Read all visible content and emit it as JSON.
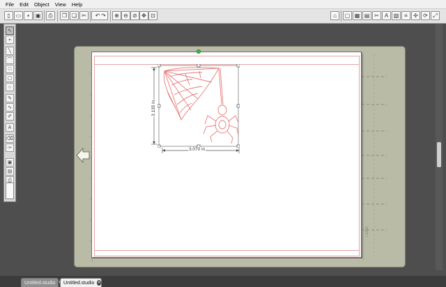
{
  "menu": [
    "File",
    "Edit",
    "Object",
    "View",
    "Help"
  ],
  "toolbar": {
    "left_icons": [
      "new-icon",
      "open-icon",
      "save-icon",
      "save-as-icon",
      "print-icon",
      "cut-icon",
      "copy-icon",
      "paste-icon",
      "scissors-icon",
      "undo-icon",
      "redo-icon",
      "zoom-in-icon",
      "zoom-out-icon",
      "zoom-box-icon",
      "pan-icon",
      "fit-to-window-icon"
    ],
    "right_icons": [
      "store-icon",
      "page-settings-icon",
      "grid-icon",
      "registration-icon",
      "cut-settings-icon",
      "text-style-icon",
      "fill-color-icon",
      "line-color-icon",
      "line-style-icon",
      "move-icon",
      "rotate-icon",
      "scale-icon",
      "replicate-icon",
      "trace-icon"
    ]
  },
  "tools": [
    "select-tool",
    "point-edit-tool",
    "line-tool",
    "polygon-tool",
    "curve-tool",
    "arc-tool",
    "rectangle-tool",
    "rounded-rectangle-tool",
    "ellipse-tool",
    "polyline-tool",
    "freehand-tool",
    "smooth-freehand-tool",
    "text-tool",
    "eraser-tool",
    "knife-tool",
    "zoom-mode-tool",
    "library-tool",
    "send-to-cutter-tool"
  ],
  "design": {
    "width_label": "3.070 in",
    "height_label": "3.135 in"
  },
  "mat": {
    "label": "Letter"
  },
  "tabs": [
    {
      "label": "Untitled.studio",
      "active": false
    },
    {
      "label": "Untitled.studio",
      "active": true
    }
  ],
  "colors": {
    "cut_line": "#e7a2a2",
    "mat": "#b9bba6",
    "rotate_handle": "#3cbf3c"
  }
}
